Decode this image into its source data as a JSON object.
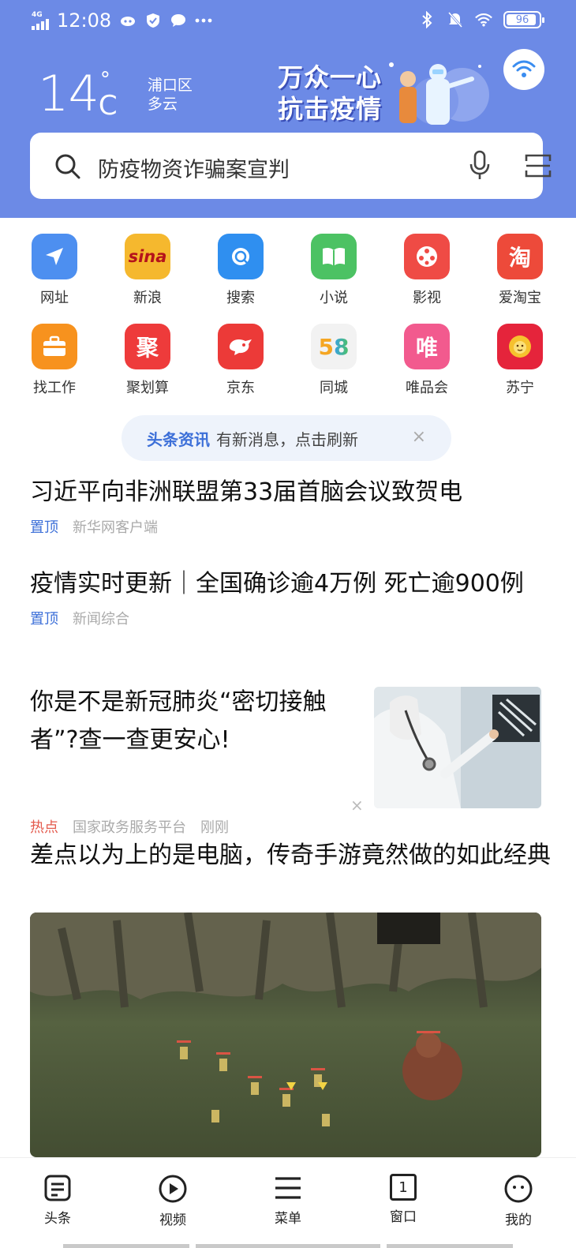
{
  "status_bar": {
    "network": "4G",
    "time": "12:08",
    "battery": "96"
  },
  "weather": {
    "temp": "14",
    "degree": "°",
    "unit": "C",
    "district": "浦口区",
    "condition": "多云"
  },
  "banner": {
    "line1": "万众一心",
    "line2": "抗击疫情"
  },
  "search": {
    "text": "防疫物资诈骗案宣判"
  },
  "shortcuts": [
    {
      "label": "网址",
      "glyph": "",
      "color": "#4d8ff0",
      "icon": "navigation-arrow-icon"
    },
    {
      "label": "新浪",
      "glyph": "sina",
      "color": "#f5b82e",
      "icon": "sina-logo-icon"
    },
    {
      "label": "搜索",
      "glyph": "",
      "color": "#2f8ff0",
      "icon": "search-icon"
    },
    {
      "label": "小说",
      "glyph": "",
      "color": "#4cc263",
      "icon": "book-icon"
    },
    {
      "label": "影视",
      "glyph": "",
      "color": "#ef4b45",
      "icon": "film-reel-icon"
    },
    {
      "label": "爱淘宝",
      "glyph": "淘",
      "color": "#ed4a3a",
      "icon": "taobao-logo-icon"
    },
    {
      "label": "找工作",
      "glyph": "",
      "color": "#f7921e",
      "icon": "briefcase-icon"
    },
    {
      "label": "聚划算",
      "glyph": "聚",
      "color": "#ee3b3b",
      "icon": "juhuasuan-logo-icon"
    },
    {
      "label": "京东",
      "glyph": "",
      "color": "#ec3a38",
      "icon": "jd-dog-logo-icon"
    },
    {
      "label": "同城",
      "glyph": "58",
      "color": "#f2f2f2",
      "icon": "58-logo-icon"
    },
    {
      "label": "唯品会",
      "glyph": "唯",
      "color": "#f25a8e",
      "icon": "vip-logo-icon"
    },
    {
      "label": "苏宁",
      "glyph": "",
      "color": "#e5243b",
      "icon": "suning-lion-logo-icon"
    }
  ],
  "refresh_pill": {
    "strong": "头条资讯",
    "text": "有新消息，点击刷新",
    "close": "×"
  },
  "feed": [
    {
      "title": "习近平向非洲联盟第33届首脑会议致贺电",
      "tag": "置顶",
      "source": "新华网客户端"
    },
    {
      "title": "疫情实时更新｜全国确诊逾4万例 死亡逾900例",
      "tag": "置顶",
      "source": "新闻综合"
    },
    {
      "title": "你是不是新冠肺炎“密切接触者”?查一查更安心!",
      "tag": "热点",
      "source": "国家政务服务平台",
      "time": "刚刚",
      "close": "×"
    },
    {
      "title": "差点以为上的是电脑，传奇手游竟然做的如此经典"
    }
  ],
  "bottom_nav": [
    {
      "label": "头条",
      "icon": "news-icon"
    },
    {
      "label": "视频",
      "icon": "play-icon"
    },
    {
      "label": "菜单",
      "icon": "menu-icon"
    },
    {
      "label": "窗口",
      "icon": "window-icon",
      "count": "1"
    },
    {
      "label": "我的",
      "icon": "profile-face-icon"
    }
  ]
}
